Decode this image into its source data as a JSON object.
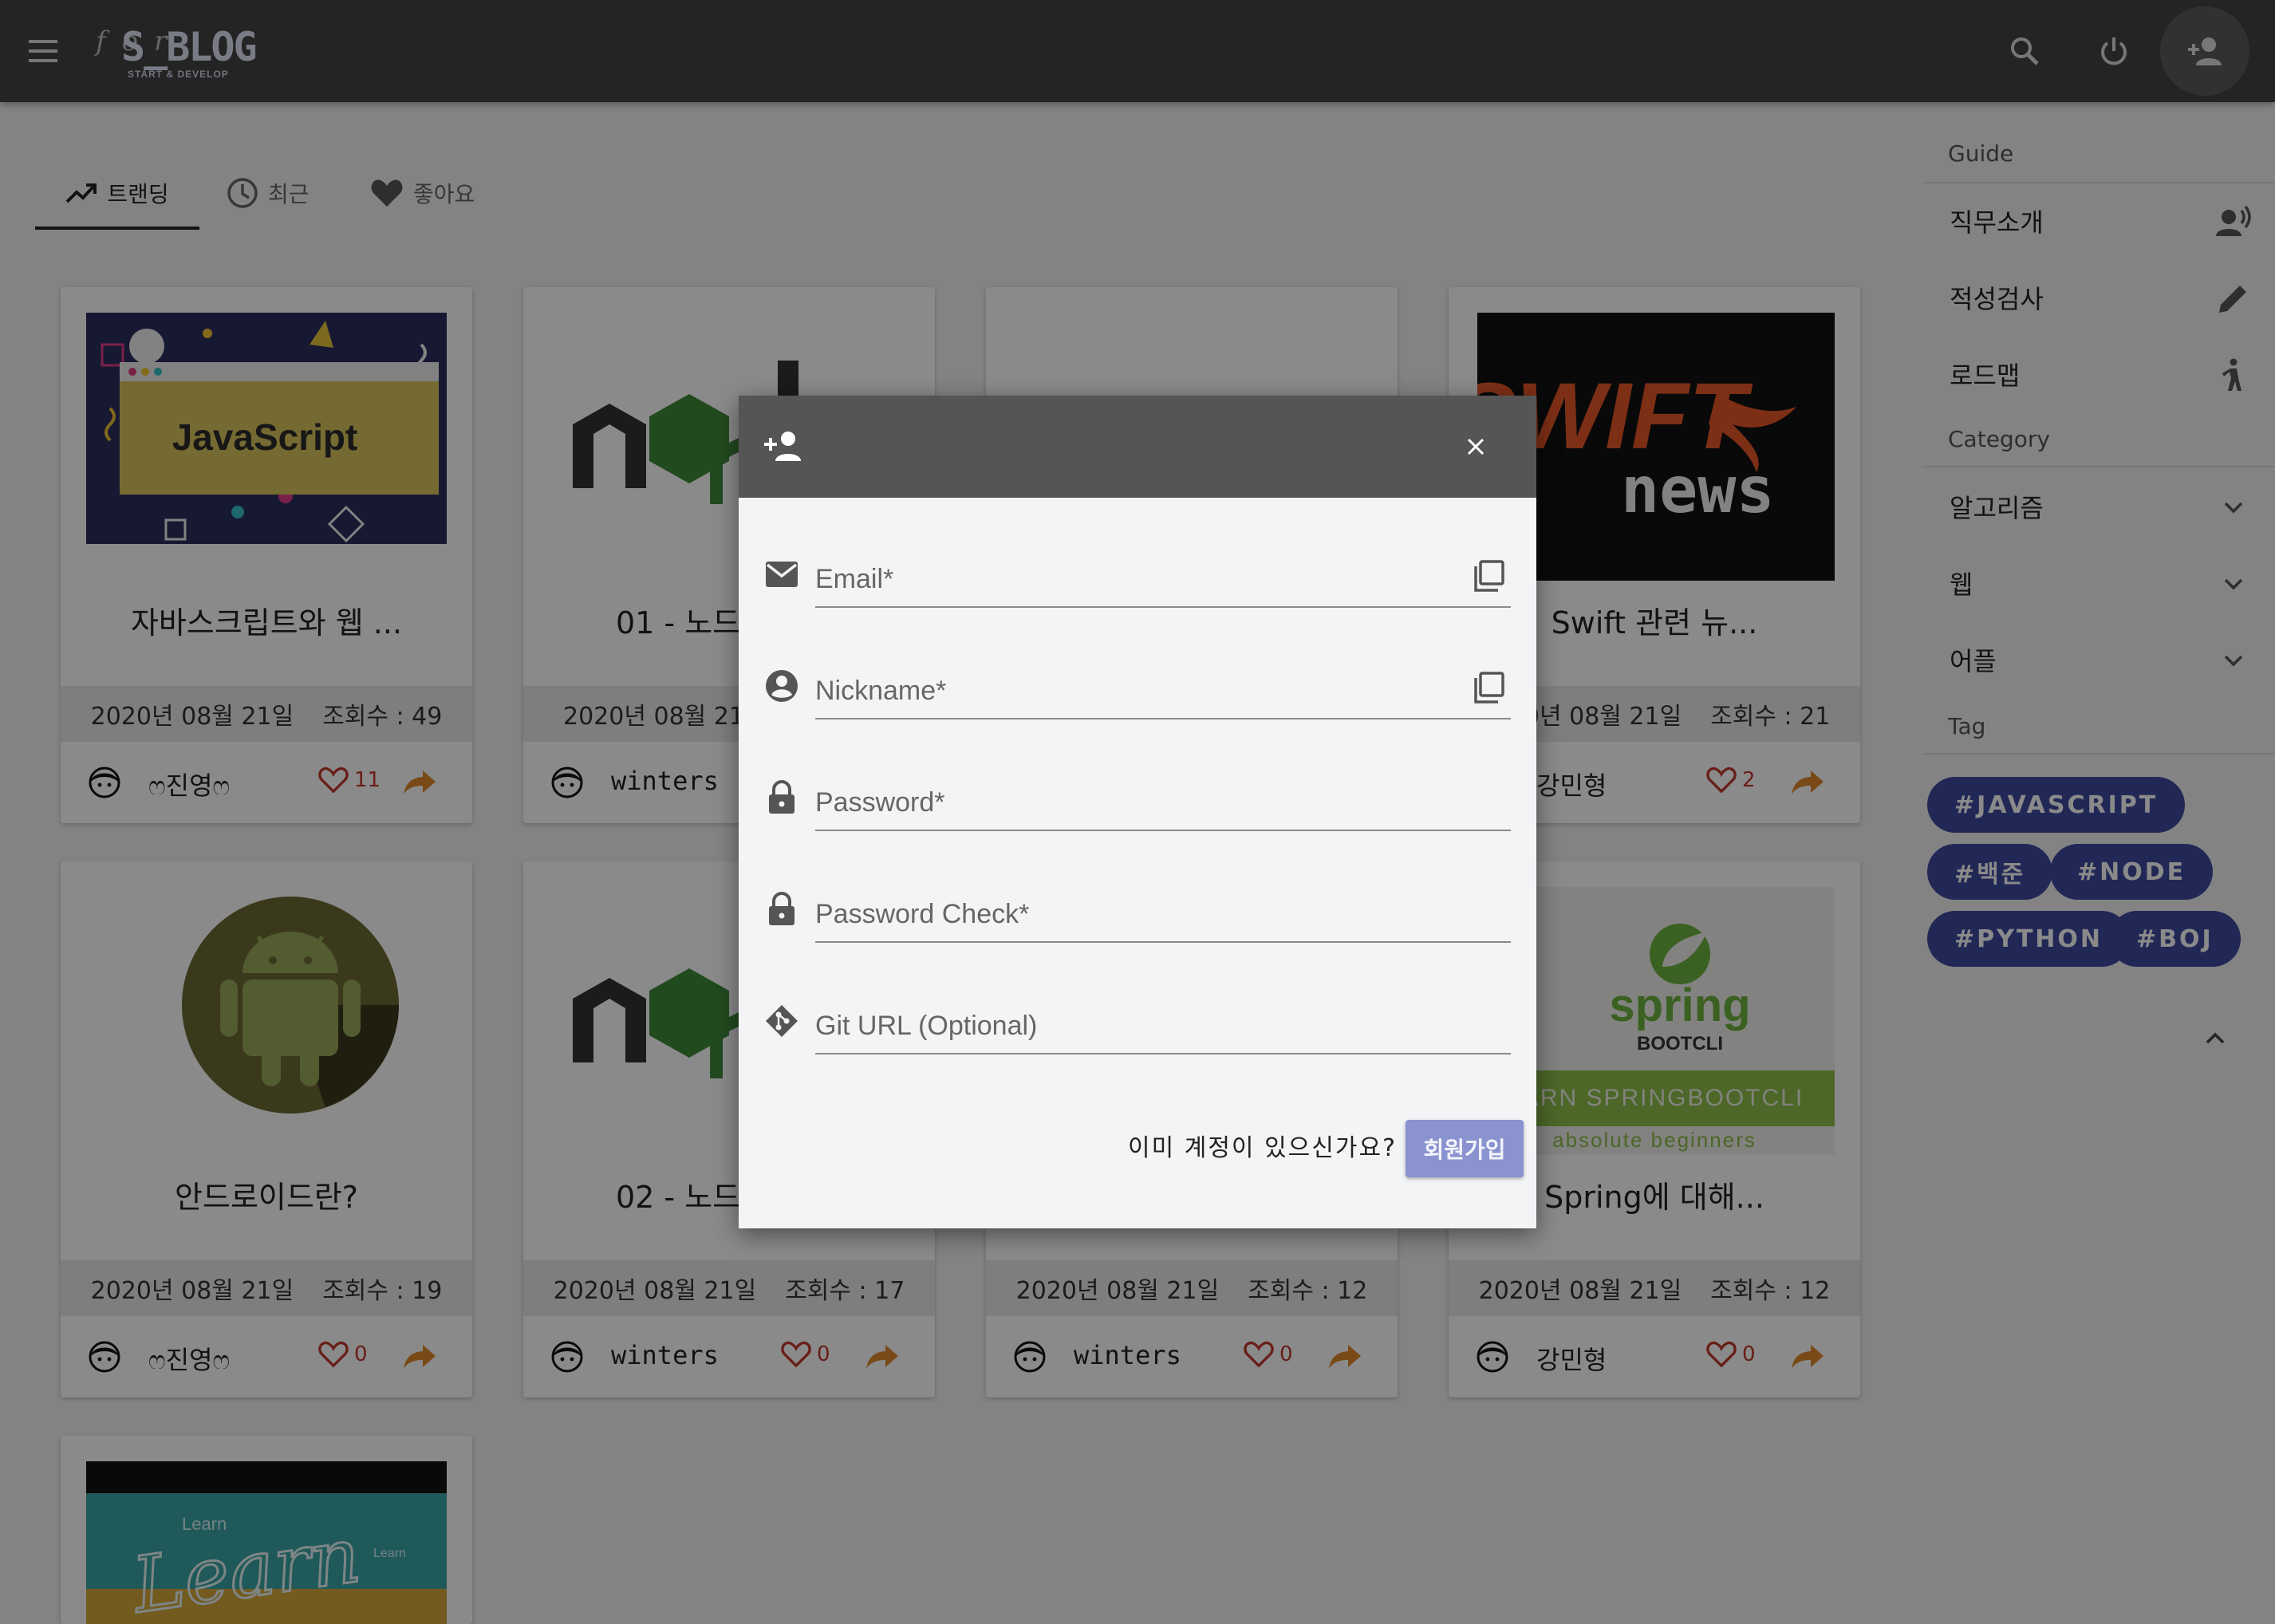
{
  "header": {
    "logo_script": "for",
    "logo_name": "S_BLOG",
    "logo_tagline": "START & DEVELOP",
    "icons": [
      "menu-icon",
      "search-icon",
      "power-icon",
      "person-add-icon"
    ]
  },
  "tabs": [
    {
      "label": "트랜딩",
      "icon": "trending-up-icon",
      "active": true
    },
    {
      "label": "최근",
      "icon": "clock-icon",
      "active": false
    },
    {
      "label": "좋아요",
      "icon": "heart-icon",
      "active": false
    }
  ],
  "cards": [
    {
      "thumb": "JavaScript",
      "title": "자바스크립트와 웹 ...",
      "date": "2020년 08월 21일",
      "views": "조회수 : 49",
      "author": "ෆ진영ෆ",
      "likes": "11"
    },
    {
      "thumb": "node",
      "title": "01 - 노드",
      "date": "2020년 08월 21일",
      "views": "",
      "author": "winters",
      "likes": ""
    },
    {
      "thumb": "",
      "title": "",
      "date": "",
      "views": "",
      "author": "",
      "likes": ""
    },
    {
      "thumb": "SWIFT news",
      "title": "Swift 관련 뉴...",
      "date": "2020년 08월 21일",
      "views": "조회수 : 21",
      "author": "강민형",
      "likes": "2"
    },
    {
      "thumb": "android",
      "title": "안드로이드란?",
      "date": "2020년 08월 21일",
      "views": "조회수 : 19",
      "author": "ෆ진영ෆ",
      "likes": "0"
    },
    {
      "thumb": "node",
      "title": "02 - 노드",
      "date": "2020년 08월 21일",
      "views": "조회수 : 17",
      "author": "winters",
      "likes": "0"
    },
    {
      "thumb": "",
      "title": "",
      "date": "2020년 08월 21일",
      "views": "조회수 : 12",
      "author": "winters",
      "likes": "0"
    },
    {
      "thumb": "spring BOOTCLI",
      "title": "Spring에 대해...",
      "date": "2020년 08월 21일",
      "views": "조회수 : 12",
      "author": "강민형",
      "likes": "0"
    },
    {
      "thumb": "Learn",
      "title": "",
      "date": "",
      "views": "",
      "author": "",
      "likes": ""
    }
  ],
  "thumb_text": {
    "javascript": "JavaScript",
    "swift_1": "SWIFT",
    "swift_2": "news",
    "spring_1": "spring",
    "spring_2": "BOOTCLI",
    "spring_3": "EARN SPRINGBOOTCLI",
    "spring_4": "absolute beginners",
    "learn": "Learn"
  },
  "sidebar": {
    "guide_label": "Guide",
    "guide_items": [
      {
        "label": "직무소개",
        "icon": "record-voice-icon"
      },
      {
        "label": "적성검사",
        "icon": "pencil-icon"
      },
      {
        "label": "로드맵",
        "icon": "walk-icon"
      }
    ],
    "category_label": "Category",
    "category_items": [
      {
        "label": "알고리즘",
        "icon": "chevron-down-icon"
      },
      {
        "label": "웹",
        "icon": "chevron-down-icon"
      },
      {
        "label": "어플",
        "icon": "chevron-down-icon"
      }
    ],
    "tag_label": "Tag",
    "tags": [
      "#JAVASCRIPT",
      "#백준",
      "#NODE",
      "#PYTHON",
      "#BOJ"
    ]
  },
  "modal": {
    "fields": [
      {
        "placeholder": "Email*",
        "icon": "mail-icon",
        "paste": true
      },
      {
        "placeholder": "Nickname*",
        "icon": "account-circle-icon",
        "paste": true
      },
      {
        "placeholder": "Password*",
        "icon": "lock-icon",
        "paste": false
      },
      {
        "placeholder": "Password Check*",
        "icon": "lock-icon",
        "paste": false
      },
      {
        "placeholder": "Git URL (Optional)",
        "icon": "git-icon",
        "paste": false
      }
    ],
    "account_text": "이미 계정이 있으신가요?",
    "submit_label": "회원가입"
  },
  "colors": {
    "topbar": "#444444",
    "tag_chip": "#3f4aa0",
    "submit_button": "#8a93d0",
    "like_heart": "#c0392b",
    "share_arrow": "#e08a2c"
  }
}
